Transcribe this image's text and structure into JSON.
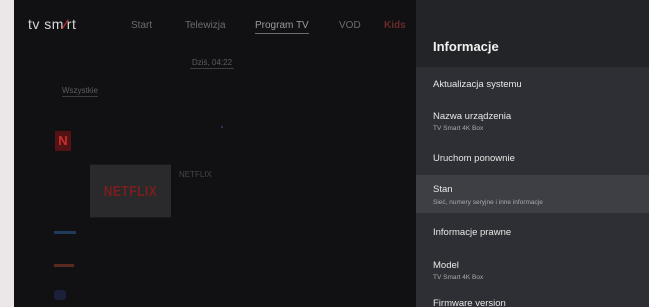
{
  "app": {
    "logo_left": "tv sm",
    "logo_x": "⁄",
    "logo_right": "rt",
    "nav": [
      "Start",
      "Telewizja",
      "Program TV",
      "VOD",
      "Kids"
    ],
    "time": "Dziś, 04:22",
    "filter": "Wszystkie",
    "netflix_card": "NETFLIX",
    "netflix_title": "NETFLIX",
    "n_logo": "N"
  },
  "settings": {
    "title": "Informacje",
    "items": [
      {
        "title": "Aktualizacja systemu",
        "subtitle": ""
      },
      {
        "title": "Nazwa urządzenia",
        "subtitle": "TV Smart 4K Box"
      },
      {
        "title": "Uruchom ponownie",
        "subtitle": ""
      },
      {
        "title": "Stan",
        "subtitle": "Sieć, numery seryjne i inne informacje"
      },
      {
        "title": "Informacje prawne",
        "subtitle": ""
      },
      {
        "title": "Model",
        "subtitle": "TV Smart 4K Box"
      },
      {
        "title": "Firmware version",
        "subtitle": ""
      }
    ],
    "focused_index": 3
  }
}
